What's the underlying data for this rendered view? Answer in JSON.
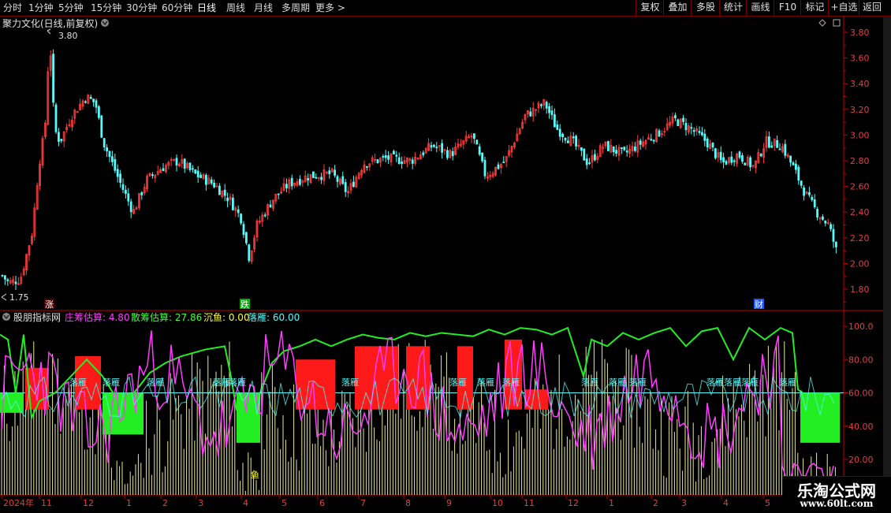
{
  "topbar": {
    "timeframes": [
      "分时",
      "1分钟",
      "5分钟",
      "15分钟",
      "30分钟",
      "60分钟",
      "日线",
      "周线",
      "月线",
      "多周期",
      "更多"
    ],
    "active": "日线",
    "more_arrow": ">",
    "right_buttons": [
      "复权",
      "叠加",
      "多股",
      "统计",
      "画线",
      "F10",
      "标记",
      "+自选",
      "返回"
    ]
  },
  "main_chart": {
    "title": "聚力文化(日线,前复权)",
    "y_ticks": [
      "3.80",
      "3.60",
      "3.40",
      "3.20",
      "3.00",
      "2.80",
      "2.60",
      "2.40",
      "2.20",
      "2.00",
      "1.80"
    ],
    "high_label": "3.80",
    "low_label": "1.75",
    "markers": [
      "涨",
      "跌",
      "财"
    ],
    "colors": {
      "up": "#ff3c3c",
      "down": "#54fcfc",
      "grid": "#7a0000",
      "axis": "#c00000"
    }
  },
  "indicator": {
    "name": "股朋指标网",
    "values": [
      {
        "label": "庄筹估算:",
        "value": "4.80",
        "color": "#ff3cff"
      },
      {
        "label": "散筹估算:",
        "value": "27.86",
        "color": "#3cff3c"
      },
      {
        "label": "沉鱼:",
        "value": "0.00",
        "color": "#ffff3c"
      },
      {
        "label": "落雁:",
        "value": "60.00",
        "color": "#54fcfc"
      }
    ],
    "y_ticks": [
      "100.0",
      "80.00",
      "60.00",
      "40.00",
      "20.00"
    ],
    "falling_goose_label": "落雁",
    "sinking_fish_label": "鱼"
  },
  "x_axis": {
    "labels": [
      "2024年",
      "11",
      "12",
      "1",
      "2",
      "3",
      "4",
      "5",
      "6",
      "7",
      "8",
      "9",
      "10",
      "11",
      "12",
      "1",
      "2",
      "3",
      "4",
      "5"
    ]
  },
  "watermark": {
    "line1": "乐淘公式网",
    "line2": "www.60lt.com"
  }
}
